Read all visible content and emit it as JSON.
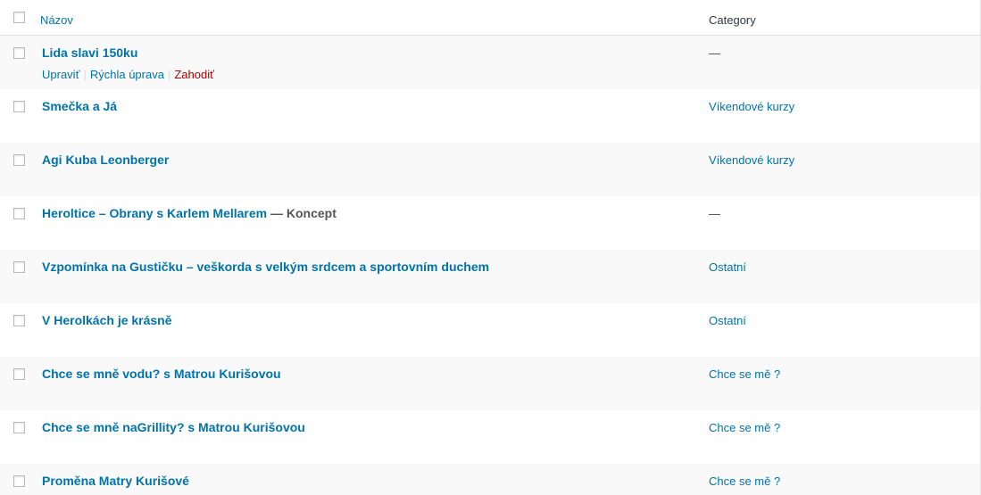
{
  "header": {
    "title_col": "Názov",
    "category_col": "Category"
  },
  "rows": [
    {
      "title": "Lida slavi 150ku",
      "state": "",
      "category": "—",
      "actions": {
        "edit": "Upraviť",
        "quick": "Rýchla úprava",
        "trash": "Zahodiť"
      }
    },
    {
      "title": "Smečka a Já",
      "state": "",
      "category": "Víkendové kurzy"
    },
    {
      "title": "Agi Kuba Leonberger",
      "state": "",
      "category": "Víkendové kurzy"
    },
    {
      "title": "Heroltice – Obrany s Karlem Mellarem",
      "state": "— Koncept",
      "category": "—"
    },
    {
      "title": "Vzpomínka na Gustičku – veškorda s velkým srdcem a sportovním duchem",
      "state": "",
      "category": "Ostatní"
    },
    {
      "title": "V Herolkách je krásně",
      "state": "",
      "category": "Ostatní"
    },
    {
      "title": "Chce se mně vodu? s Matrou Kurišovou",
      "state": "",
      "category": "Chce se mě ?"
    },
    {
      "title": "Chce se mně naGrillity? s Matrou Kurišovou",
      "state": "",
      "category": "Chce se mě ?"
    },
    {
      "title": "Proměna Matry Kurišové",
      "state": "",
      "category": "Chce se mě ?"
    }
  ]
}
